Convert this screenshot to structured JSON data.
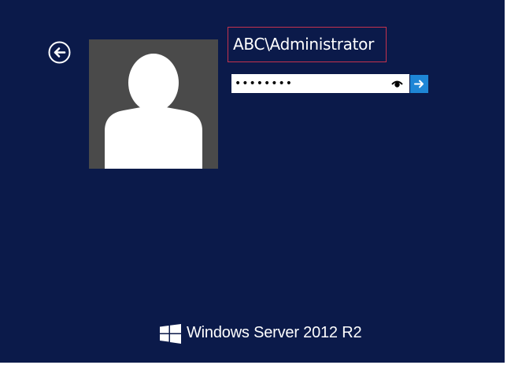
{
  "login": {
    "username": "ABC\\Administrator",
    "password_value": "••••••••"
  },
  "icons": {
    "back": "back-arrow-icon",
    "avatar": "user-silhouette-icon",
    "reveal": "eye-icon",
    "submit": "arrow-right-icon",
    "logo": "windows-logo-icon"
  },
  "branding": {
    "product": "Windows Server 2012 R2"
  },
  "colors": {
    "background": "#0b1a4a",
    "avatar_tile": "#4a4a4a",
    "highlight_border": "#c4324e",
    "submit_button": "#1e86d6"
  }
}
